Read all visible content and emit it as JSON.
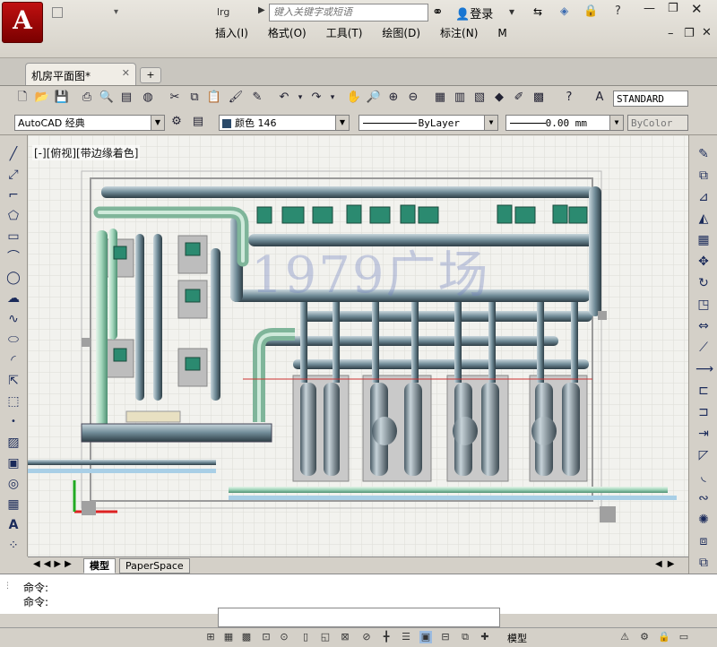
{
  "app": {
    "logo_letter": "A",
    "drawing_name": "lrg"
  },
  "search": {
    "placeholder": "键入关键字或短语",
    "value": ""
  },
  "user": {
    "login_label": "登录"
  },
  "menu": [
    "插入(I)",
    "格式(O)",
    "工具(T)",
    "绘图(D)",
    "标注(N)",
    "M"
  ],
  "tabs": {
    "doc_tab": "机房平面图*",
    "new_tab": "+"
  },
  "toolbar2": {
    "workspace": "AutoCAD 经典",
    "color_prefix": "颜色",
    "color_value": "146",
    "linetype": "ByLayer",
    "lineweight": "0.00 mm",
    "plotstyle": "ByColor",
    "textstyle": "STANDARD"
  },
  "viewport": {
    "label": "[-][俯视][带边缘着色]"
  },
  "watermark": {
    "text": "1979广场"
  },
  "layout_tabs": [
    "模型",
    "PaperSpace"
  ],
  "command": {
    "line1": "命令:",
    "line2": "命令:"
  },
  "status": {
    "model_label": "模型"
  },
  "colors": {
    "pipe": "#6f8a96",
    "pipe_green": "#9fd4b9",
    "pipe_light": "#b8d9ef",
    "pump": "#2b8a70",
    "grid_bg": "#f2f2ee"
  }
}
